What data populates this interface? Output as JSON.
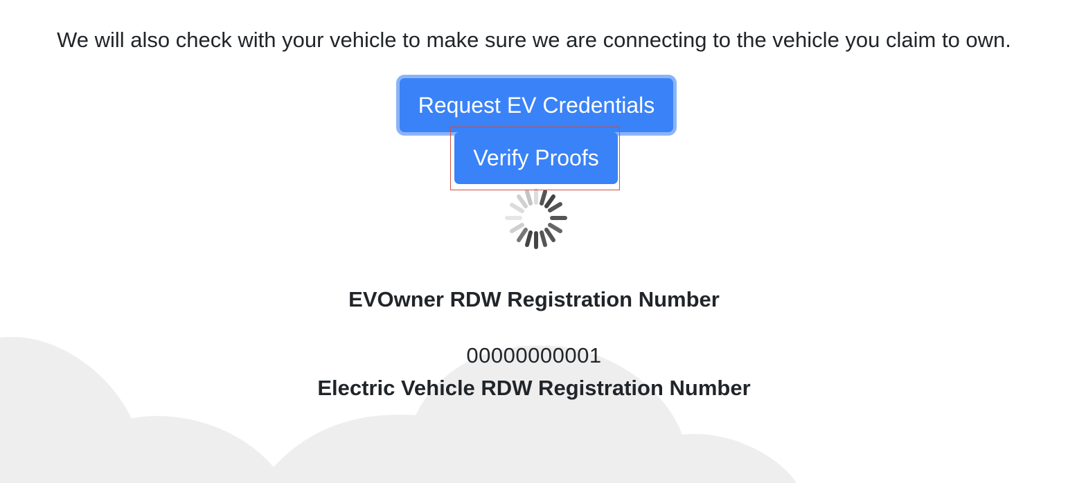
{
  "intro_text": "We will also check with your vehicle to make sure we are connecting to the vehicle you claim to own.",
  "buttons": {
    "request_label": "Request EV Credentials",
    "verify_label": "Verify Proofs"
  },
  "owner": {
    "label": "EVOwner RDW Registration Number",
    "value": "00000000001"
  },
  "vehicle": {
    "label": "Electric Vehicle RDW Registration Number"
  },
  "colors": {
    "button_primary": "#3a82f7",
    "focus_ring": "#8ab4f8",
    "highlight_border": "#d84a3a",
    "cloud": "#eeeeee"
  },
  "icons": {
    "spinner": "loading-spinner-icon"
  }
}
